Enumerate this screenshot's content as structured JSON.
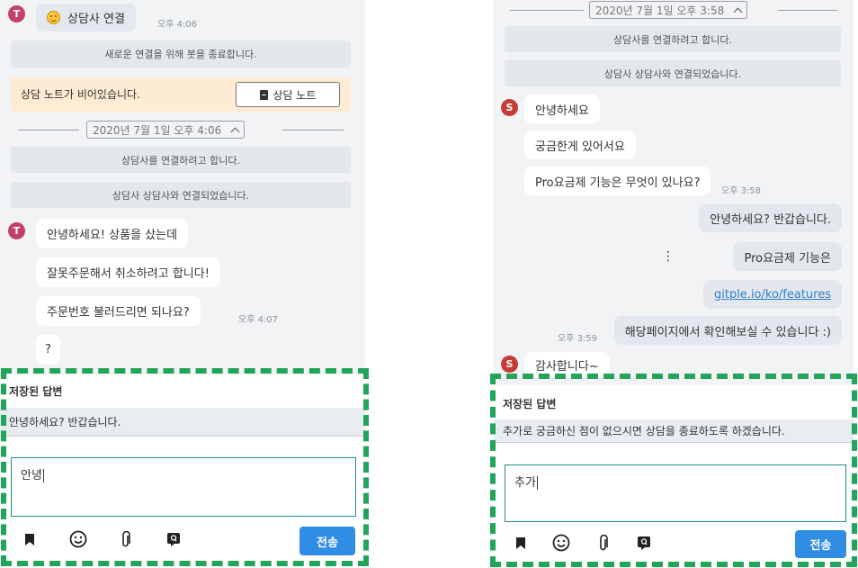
{
  "left": {
    "avatar_letter": "T",
    "greeting_bubble": "상담사 연결",
    "greeting_time": "오후 4:06",
    "sys_end_bot": "새로운 연결을 위해 봇을 종료합니다.",
    "note_text": "상담 노트가 비어있습니다.",
    "note_button": "상담 노트",
    "divider_date": "2020년 7월 1일 오후 4:06",
    "sys_connecting": "상담사를 연결하려고 합니다.",
    "sys_connected": "상담사 상담사와 연결되었습니다.",
    "messages": [
      "안녕하세요! 상품을 샀는데",
      "잘못주문해서 취소하려고 합니다!",
      "주문번호 불러드리면 되나요?",
      "?"
    ],
    "message_time": "오후 4:07",
    "saved_title": "저장된 답변",
    "saved_item": "안녕하세요? 반갑습니다.",
    "input_value": "안녕",
    "send_label": "전송"
  },
  "right": {
    "avatar_letter": "S",
    "divider_date": "2020년 7월 1일 오후 3:58",
    "sys_connecting": "상담사를 연결하려고 합니다.",
    "sys_connected": "상담사 상담사와 연결되었습니다.",
    "customer_messages": [
      "안녕하세요",
      "궁금한게 있어서요",
      "Pro요금제 기능은 무엇이 있나요?"
    ],
    "customer_time": "오후 3:58",
    "agent_messages": [
      "안녕하세요? 반갑습니다.",
      "Pro요금제 기능은",
      "gitple.io/ko/features",
      "해당페이지에서 확인해보실 수 있습니다 :)"
    ],
    "agent_time": "오후 3:59",
    "last_customer": "감사합니다~",
    "saved_title": "저장된 답변",
    "saved_item": "추가로 궁금하신 점이 없으시면 상담을 종료하도록 하겠습니다.",
    "input_value": "추가",
    "send_label": "전송"
  },
  "colors": {
    "accent_dashed": "#21a55a",
    "send_button": "#2f8de4",
    "note_bg": "#fdebd3",
    "link": "#2f80c9"
  },
  "icons": [
    "bookmark-icon",
    "emoji-icon",
    "paperclip-icon",
    "saved-reply-icon",
    "more-vertical-icon"
  ]
}
